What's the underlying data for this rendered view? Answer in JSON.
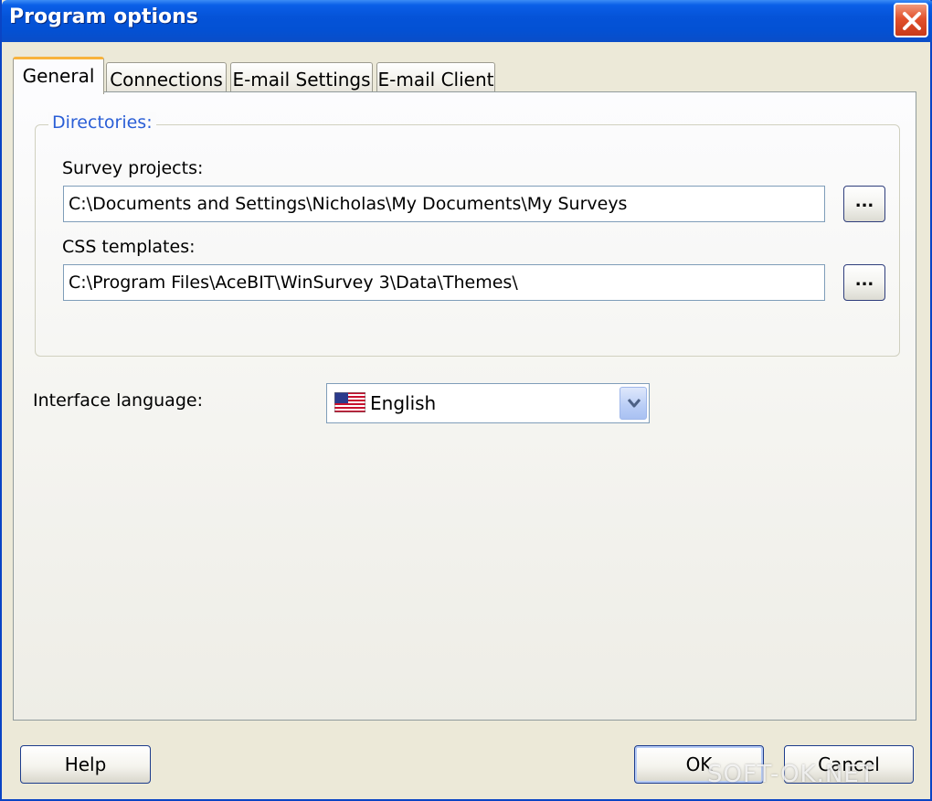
{
  "window": {
    "title": "Program options"
  },
  "tabs": [
    {
      "label": "General",
      "active": true
    },
    {
      "label": "Connections",
      "active": false
    },
    {
      "label": "E-mail Settings",
      "active": false
    },
    {
      "label": "E-mail Client",
      "active": false
    }
  ],
  "directories": {
    "legend": "Directories:",
    "survey_projects": {
      "label": "Survey projects:",
      "value": "C:\\Documents and Settings\\Nicholas\\My Documents\\My Surveys",
      "browse_label": "..."
    },
    "css_templates": {
      "label": "CSS templates:",
      "value": "C:\\Program Files\\AceBIT\\WinSurvey 3\\Data\\Themes\\",
      "browse_label": "..."
    }
  },
  "language": {
    "label": "Interface language:",
    "selected": "English",
    "flag_icon": "us-flag-icon"
  },
  "buttons": {
    "help": "Help",
    "ok": "OK",
    "cancel": "Cancel"
  },
  "watermark": "SOFT-OK.NET",
  "colors": {
    "titlebar": "#0553d8",
    "legend": "#2a5ed6",
    "active_tab_accent": "#f8b33c",
    "close_button": "#e2512c"
  }
}
